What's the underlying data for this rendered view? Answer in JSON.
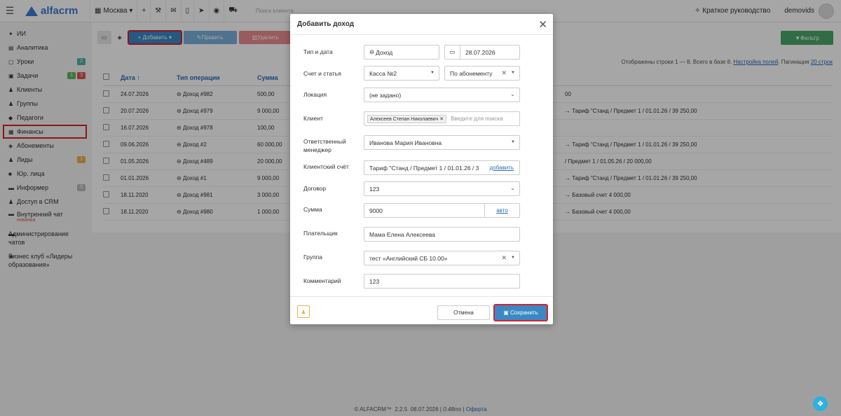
{
  "topbar": {
    "brand": "alfacrm",
    "city": "Москва ▾",
    "icons": [
      "+",
      "wrench-icon",
      "mail-icon",
      "phone-icon",
      "telegram-icon",
      "whatsapp-icon",
      "cart-icon"
    ],
    "search_placeholder": "Поиск клиента",
    "guide": "Краткое руководство",
    "user": "demovids"
  },
  "sidebar": {
    "items": [
      {
        "icon": "ai-icon",
        "label": "ИИ"
      },
      {
        "icon": "analytics-icon",
        "label": "Аналитика"
      },
      {
        "icon": "lessons-icon",
        "label": "Уроки",
        "badges": [
          "2"
        ]
      },
      {
        "icon": "tasks-icon",
        "label": "Задачи",
        "badges": [
          "1",
          "3"
        ]
      },
      {
        "icon": "clients-icon",
        "label": "Клиенты"
      },
      {
        "icon": "groups-icon",
        "label": "Группы"
      },
      {
        "icon": "teachers-icon",
        "label": "Педагоги"
      },
      {
        "icon": "finance-icon",
        "label": "Финансы"
      },
      {
        "icon": "subscriptions-icon",
        "label": "Абонементы"
      },
      {
        "icon": "leads-icon",
        "label": "Лиды",
        "badges": [
          "1"
        ]
      },
      {
        "icon": "legal-icon",
        "label": "Юр. лица"
      },
      {
        "icon": "informer-icon",
        "label": "Информер",
        "badges": [
          "5"
        ]
      },
      {
        "icon": "access-icon",
        "label": "Доступ в CRM"
      },
      {
        "icon": "chat-icon",
        "label": "Внутренний чат",
        "note": "новинка"
      },
      {
        "icon": "admin-chat-icon",
        "label": "Администрирование чатов"
      },
      {
        "icon": "star-icon",
        "label": "Бизнес клуб «Лидеры образования»"
      }
    ]
  },
  "toolbar": {
    "add_label": "+ Добавить ▾",
    "edit_label": "Править",
    "delete_label": "Удалить",
    "filter_label": "Фильтр"
  },
  "info": {
    "shown": "Отображены строки 1 — 8. Всего в базе 8.",
    "settings": "Настройка полей",
    "pagination_label": "Пагинация",
    "pagination_value": "20 строк"
  },
  "table": {
    "headers": [
      "Дата ↑",
      "Тип операции",
      "Сумма"
    ],
    "rows": [
      {
        "date": "24.07.2026",
        "type": "Доход #982",
        "sum": "500,00",
        "tail": "00"
      },
      {
        "date": "20.07.2026",
        "type": "Доход #979",
        "sum": "9 000,00",
        "tail": "→ Тариф \"Станд / Предмет 1 / 01.01.26 / 39 250,00"
      },
      {
        "date": "16.07.2026",
        "type": "Доход #978",
        "sum": "100,00",
        "tail": ""
      },
      {
        "date": "09.06.2026",
        "type": "Доход #2",
        "sum": "60 000,00",
        "tail": "→ Тариф \"Станд / Предмет 1 / 01.01.26 / 39 250,00"
      },
      {
        "date": "01.05.2026",
        "type": "Доход #489",
        "sum": "20 000,00",
        "tail": "/ Предмет 1 / 01.05.26 / 20 000,00"
      },
      {
        "date": "01.01.2026",
        "type": "Доход #1",
        "sum": "9 000,00",
        "tail": "→ Тариф \"Станд / Предмет 1 / 01.01.26 / 39 250,00"
      },
      {
        "date": "18.11.2020",
        "type": "Доход #981",
        "sum": "3 000,00",
        "tail": "→ Базовый счет 4 000,00"
      },
      {
        "date": "18.11.2020",
        "type": "Доход #980",
        "sum": "1 000,00",
        "tail": "→ Базовый счет 4 000,00"
      }
    ]
  },
  "modal": {
    "title": "Добавить доход",
    "fields": {
      "type_date": {
        "label": "Тип и дата",
        "type": "Доход",
        "date": "28.07.2026"
      },
      "account": {
        "label": "Счет и статья",
        "account": "Касса №2",
        "article": "По абонементу"
      },
      "location": {
        "label": "Локация",
        "value": "(не задано)"
      },
      "client": {
        "label": "Клиент",
        "tag": "Алексеев Степан Николаевич",
        "placeholder": "Введите для поиска"
      },
      "manager": {
        "label": "Ответственный менеджер",
        "value": "Иванова Мария Ивановна"
      },
      "client_account": {
        "label": "Клиентский счёт",
        "value": "Тариф \"Станд / Предмет 1 / 01.01.26 / 3",
        "addon": "добавить"
      },
      "contract": {
        "label": "Договор",
        "value": "123"
      },
      "sum": {
        "label": "Сумма",
        "value": "9000",
        "addon": "авто"
      },
      "payer": {
        "label": "Плательщик",
        "value": "Мама Елена Алексеева"
      },
      "group": {
        "label": "Группа",
        "value": "тест «Английский СБ 10.00»"
      },
      "comment": {
        "label": "Комментарий",
        "value": "123"
      }
    },
    "cancel": "Отмена",
    "save": "Сохранить"
  },
  "footer": {
    "brand": "© ALFACRM™",
    "version": "2.2.5",
    "date": "08.07.2026",
    "time": "0.48ms",
    "offer": "Оферта"
  },
  "colors": {
    "accent": "#3b88c5",
    "highlight": "#d9222a",
    "filter": "#4aa86a"
  }
}
